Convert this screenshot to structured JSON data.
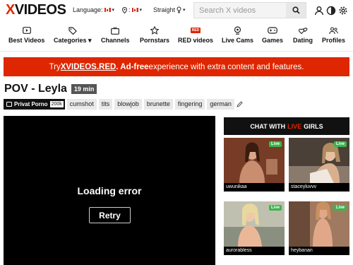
{
  "header": {
    "logo_x": "X",
    "logo_rest": "VIDEOS",
    "language_label": "Language:",
    "country_label": ":",
    "orientation_label": "Straight",
    "search_placeholder": "Search X videos"
  },
  "nav": [
    {
      "label": "Best Videos",
      "icon": "play-box-icon"
    },
    {
      "label": "Categories",
      "icon": "tags-icon"
    },
    {
      "label": "Channels",
      "icon": "tv-icon"
    },
    {
      "label": "Pornstars",
      "icon": "star-icon"
    },
    {
      "label": "RED videos",
      "icon": "red-badge-icon",
      "badge": "RED"
    },
    {
      "label": "Live Cams",
      "icon": "webcam-icon"
    },
    {
      "label": "Games",
      "icon": "gamepad-icon"
    },
    {
      "label": "Dating",
      "icon": "hearts-icon"
    },
    {
      "label": "Profiles",
      "icon": "users-icon"
    }
  ],
  "promo": {
    "pre": "Try ",
    "link": "XVIDEOS.RED",
    "bold": ". Ad-free",
    "post": " experience with extra content and features."
  },
  "video": {
    "title": "POV - Leyla",
    "duration": "19 min",
    "channel": "Privat Porno",
    "channel_count": "200k",
    "tags": [
      "cumshot",
      "tits",
      "blowjob",
      "brunette",
      "fingering",
      "german"
    ],
    "error_text": "Loading error",
    "retry_label": "Retry"
  },
  "chat": {
    "head_pre": "CHAT WITH",
    "head_live": "LIVE",
    "head_post": "GIRLS",
    "live_badge": "Live",
    "cams": [
      {
        "name": "uwunikaa"
      },
      {
        "name": "staceyluvvv"
      },
      {
        "name": "aurorabless"
      },
      {
        "name": "heybanan"
      }
    ]
  },
  "colors": {
    "brand_red": "#de2600",
    "live_green": "#3ab54a"
  }
}
